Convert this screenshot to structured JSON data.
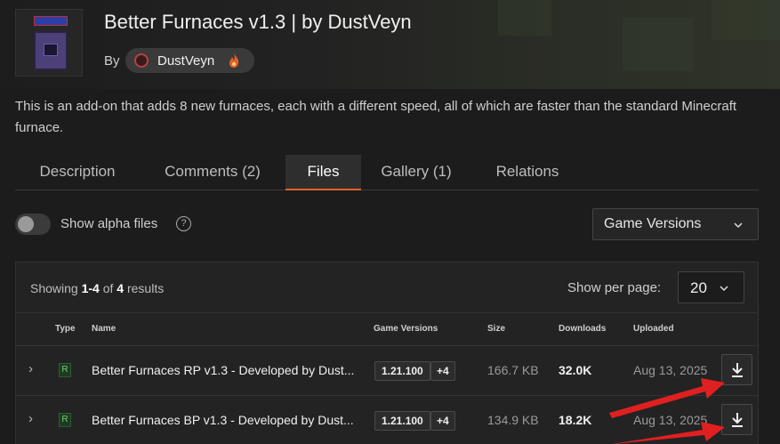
{
  "header": {
    "title": "Better Furnaces v1.3 | by DustVeyn",
    "by_label": "By",
    "author": "DustVeyn",
    "description": "This is an add-on that adds 8 new furnaces, each with a different speed, all of which are faster than the standard Minecraft furnace."
  },
  "tabs": [
    {
      "label": "Description",
      "active": false
    },
    {
      "label": "Comments (2)",
      "active": false
    },
    {
      "label": "Files",
      "active": true
    },
    {
      "label": "Gallery (1)",
      "active": false
    },
    {
      "label": "Relations",
      "active": false
    }
  ],
  "filters": {
    "alpha_label": "Show alpha files",
    "alpha_enabled": false,
    "game_versions_label": "Game Versions"
  },
  "results": {
    "showing_prefix": "Showing ",
    "range": "1-4",
    "of": " of ",
    "total": "4",
    "suffix": " results",
    "per_page_label": "Show per page:",
    "per_page_value": "20"
  },
  "columns": {
    "type": "Type",
    "name": "Name",
    "game_versions": "Game Versions",
    "size": "Size",
    "downloads": "Downloads",
    "uploaded": "Uploaded"
  },
  "files": [
    {
      "type": "R",
      "name": "Better Furnaces RP v1.3 - Developed by Dust...",
      "version": "1.21.100",
      "more": "+4",
      "size": "166.7 KB",
      "downloads": "32.0K",
      "uploaded": "Aug 13, 2025"
    },
    {
      "type": "R",
      "name": "Better Furnaces BP v1.3 - Developed by Dust...",
      "version": "1.21.100",
      "more": "+4",
      "size": "134.9 KB",
      "downloads": "18.2K",
      "uploaded": "Aug 13, 2025"
    }
  ],
  "icons": {
    "expand": "chevron-right-icon",
    "download": "download-icon",
    "select": "chevron-down-icon",
    "help": "question-circle-icon",
    "flame": "flame-icon"
  },
  "colors": {
    "accent": "#e0622a",
    "arrow_annotation": "#e02020",
    "release_type": "#6fcf6f"
  }
}
